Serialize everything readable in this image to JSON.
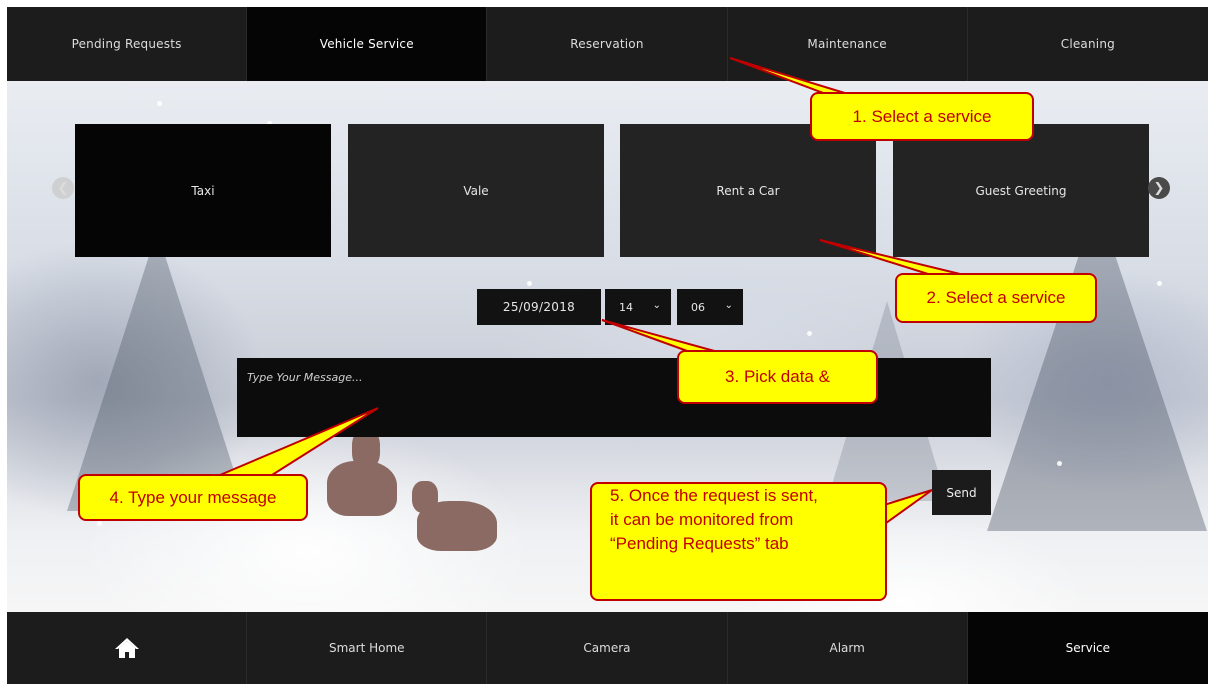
{
  "top_nav": {
    "tabs": [
      {
        "label": "Pending Requests"
      },
      {
        "label": "Vehicle Service"
      },
      {
        "label": "Reservation"
      },
      {
        "label": "Maintenance"
      },
      {
        "label": "Cleaning"
      }
    ],
    "active_tab": "Vehicle Service"
  },
  "services": {
    "cards": [
      {
        "label": "Taxi"
      },
      {
        "label": "Vale"
      },
      {
        "label": "Rent a Car"
      },
      {
        "label": "Guest Greeting"
      }
    ],
    "selected": "Taxi",
    "prev_icon": "chevron-left-icon",
    "next_icon": "chevron-right-icon"
  },
  "schedule": {
    "date": "25/09/2018",
    "hour": "14",
    "minute": "06"
  },
  "message": {
    "placeholder": "Type Your Message..."
  },
  "send_label": "Send",
  "bottom_nav": {
    "home_icon": "home-icon",
    "tabs": [
      {
        "label": "Smart Home"
      },
      {
        "label": "Camera"
      },
      {
        "label": "Alarm"
      },
      {
        "label": "Service"
      }
    ],
    "active_tab": "Service"
  },
  "callouts": {
    "c1": "1. Select a service",
    "c2": "2. Select a service",
    "c3": "3. Pick data &",
    "c4": "4. Type your message",
    "c5_line1": "5. Once the request is sent,",
    "c5_line2": "it can be monitored from",
    "c5_line3": "“Pending Requests” tab"
  },
  "colors": {
    "callout_fill": "#ffff00",
    "callout_border": "#c00000",
    "active_tab_bg": "#050505",
    "tab_bg": "#1c1c1c"
  }
}
